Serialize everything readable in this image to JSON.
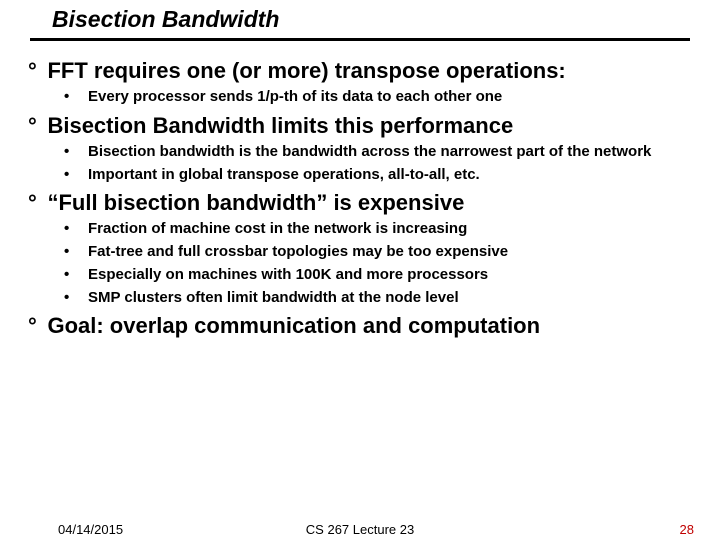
{
  "title": "Bisection Bandwidth",
  "points": [
    {
      "text": "FFT requires one (or more) transpose operations:",
      "subs": [
        "Every processor sends 1/p-th of its data to each other one"
      ]
    },
    {
      "text": "Bisection Bandwidth limits this performance",
      "subs": [
        "Bisection bandwidth is the bandwidth across the narrowest part of the network",
        "Important in global transpose operations, all-to-all, etc."
      ]
    },
    {
      "text": "“Full bisection bandwidth” is expensive",
      "subs": [
        "Fraction of machine cost in the network is increasing",
        "Fat-tree and full crossbar topologies may be too expensive",
        "Especially on machines with 100K and more processors",
        "SMP clusters often limit bandwidth at the node level"
      ]
    },
    {
      "text": "Goal: overlap communication and computation",
      "subs": []
    }
  ],
  "footer": {
    "date": "04/14/2015",
    "center": "CS 267 Lecture 23",
    "num": "28"
  }
}
